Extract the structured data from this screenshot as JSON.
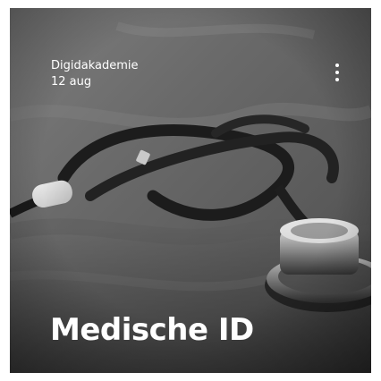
{
  "card": {
    "author": "Digidakademie",
    "date": "12 aug",
    "title": "Medische ID",
    "menu_icon": "more-vertical-icon",
    "image_subject": "stethoscope-photo"
  }
}
